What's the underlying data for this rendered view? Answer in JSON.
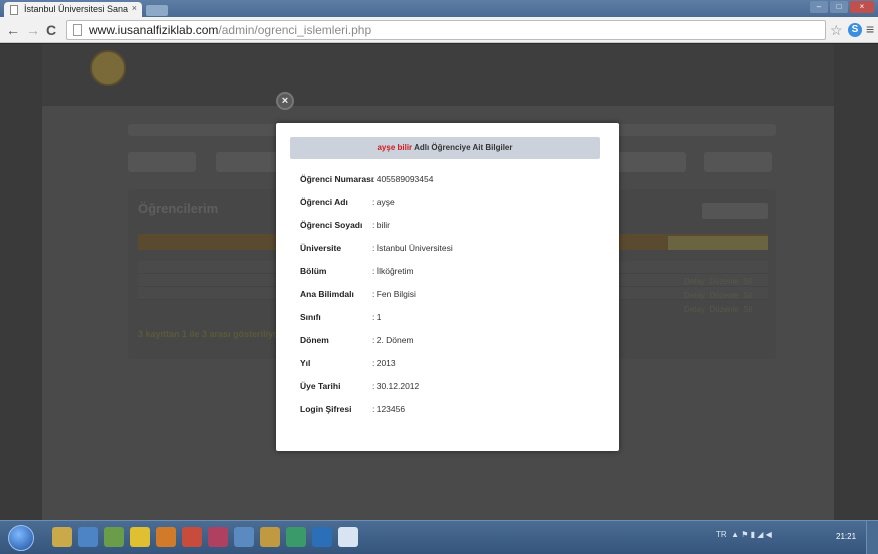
{
  "browser": {
    "tab_title": "İstanbul Üniversitesi Sana",
    "tab_close": "×",
    "back": "←",
    "forward": "→",
    "reload": "C",
    "url_host": "www.iusanalfiziklab.com",
    "url_path": "/admin/ogrenci_islemleri.php",
    "star": "☆",
    "extension": "S",
    "menu": "≡"
  },
  "modal": {
    "close": "×",
    "title_name": "ayşe bilir",
    "title_rest": " Adlı Öğrenciye Ait Bilgiler",
    "fields": [
      {
        "label": "Öğrenci Numarası",
        "value": ": 405589093454"
      },
      {
        "label": "Öğrenci Adı",
        "value": ": ayşe"
      },
      {
        "label": "Öğrenci Soyadı",
        "value": ": bilir"
      },
      {
        "label": "Üniversite",
        "value": ": İstanbul Üniversitesi"
      },
      {
        "label": "Bölüm",
        "value": ": İlköğretim"
      },
      {
        "label": "Ana Bilimdalı",
        "value": ": Fen Bilgisi"
      },
      {
        "label": "Sınıfı",
        "value": ": 1"
      },
      {
        "label": "Dönem",
        "value": ": 2. Dönem"
      },
      {
        "label": "Yıl",
        "value": ": 2013"
      },
      {
        "label": "Üye Tarihi",
        "value": ": 30.12.2012"
      },
      {
        "label": "Login Şifresi",
        "value": ": 123456"
      }
    ]
  },
  "background": {
    "page_title": "Öğrencilerim",
    "rows_summary": "3 kayıttan 1 ile 3 arası gösteriliyor",
    "action_labels": [
      "Detay",
      "Düzenle",
      "Sil"
    ]
  },
  "taskbar": {
    "lang": "TR",
    "clock": "21:21"
  },
  "colors": {
    "modal_title_name": "#cc1c1c",
    "modal_header_bg": "#ccd2dc",
    "overlay_bg": "#3a3a3a"
  }
}
